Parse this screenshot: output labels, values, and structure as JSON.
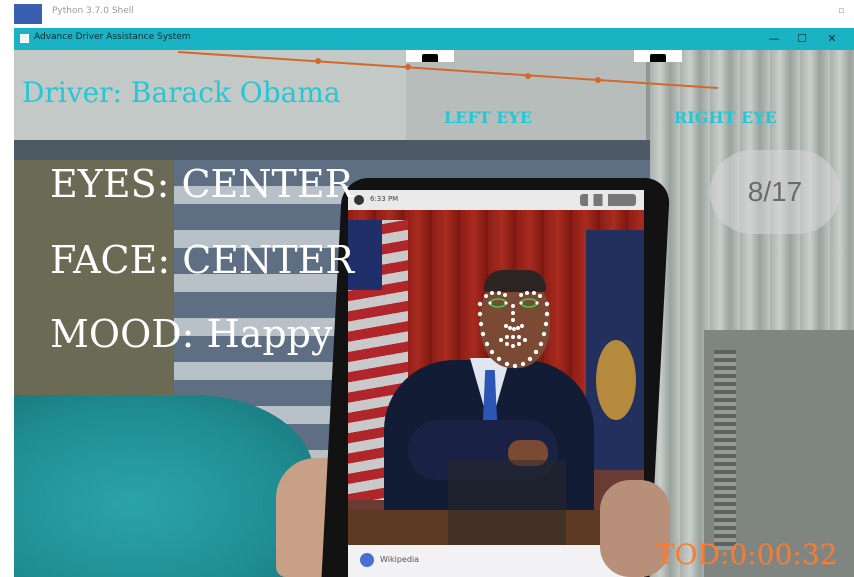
{
  "background_window": {
    "title": "Python 3.7.0 Shell"
  },
  "window": {
    "title": "Advance Driver Assistance System",
    "controls": {
      "minimize": "—",
      "maximize": "☐",
      "close": "✕"
    }
  },
  "hud": {
    "driver": "Driver: Barack Obama",
    "left_eye_label": "LEFT EYE",
    "right_eye_label": "RIGHT EYE",
    "eyes_status": "EYES: CENTER",
    "face_status": "FACE: CENTER",
    "mood_status": "MOOD: Happy",
    "timer": "TOD:0:00:32",
    "colors": {
      "cyan_text": "#25c7d6",
      "white_text": "#ffffff",
      "orange_timer": "#ff7a2e",
      "landmarks": "#ffffff",
      "eye_landmarks": "#33d24a"
    }
  },
  "phone": {
    "status_time": "6:33 PM",
    "bottom_bar": "Wikipedia"
  },
  "counter": "8/17"
}
